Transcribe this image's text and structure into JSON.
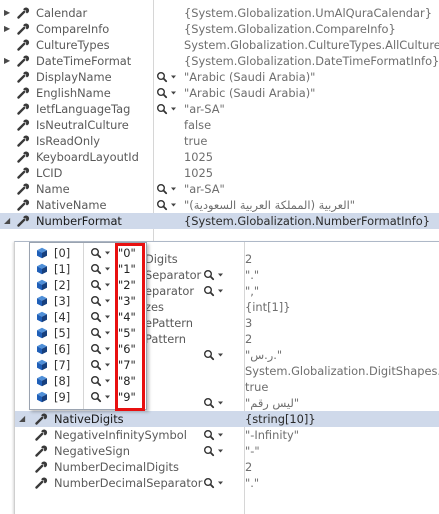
{
  "rows": [
    {
      "name": "Calendar",
      "value": "{System.Globalization.UmAlQuraCalendar}",
      "expandable": true,
      "magnifier": false
    },
    {
      "name": "CompareInfo",
      "value": "{System.Globalization.CompareInfo}",
      "expandable": true,
      "magnifier": false
    },
    {
      "name": "CultureTypes",
      "value": "System.Globalization.CultureTypes.AllCultures",
      "expandable": false,
      "magnifier": false
    },
    {
      "name": "DateTimeFormat",
      "value": "{System.Globalization.DateTimeFormatInfo}",
      "expandable": true,
      "magnifier": false
    },
    {
      "name": "DisplayName",
      "value": "\"Arabic (Saudi Arabia)\"",
      "expandable": false,
      "magnifier": true
    },
    {
      "name": "EnglishName",
      "value": "\"Arabic (Saudi Arabia)\"",
      "expandable": false,
      "magnifier": true
    },
    {
      "name": "IetfLanguageTag",
      "value": "\"ar-SA\"",
      "expandable": false,
      "magnifier": true
    },
    {
      "name": "IsNeutralCulture",
      "value": "false",
      "expandable": false,
      "magnifier": false
    },
    {
      "name": "IsReadOnly",
      "value": "true",
      "expandable": false,
      "magnifier": false
    },
    {
      "name": "KeyboardLayoutId",
      "value": "1025",
      "expandable": false,
      "magnifier": false
    },
    {
      "name": "LCID",
      "value": "1025",
      "expandable": false,
      "magnifier": false
    },
    {
      "name": "Name",
      "value": "\"ar-SA\"",
      "expandable": false,
      "magnifier": true
    },
    {
      "name": "NativeName",
      "value": "\"العربية (المملكة العربية السعودية)\"",
      "expandable": false,
      "magnifier": true
    },
    {
      "name": "NumberFormat",
      "value": "{System.Globalization.NumberFormatInfo}",
      "expandable": true,
      "magnifier": false,
      "expanded": true,
      "selected": true
    }
  ],
  "sub_rows": [
    {
      "name_visible": "Digits",
      "value": "2",
      "magnifier": false
    },
    {
      "name_visible": "Separator",
      "value": "\".\"",
      "magnifier": true
    },
    {
      "name_visible": "eparator",
      "value": "\",\"",
      "magnifier": true
    },
    {
      "name_visible": "zes",
      "value": "{int[1]}",
      "magnifier": false
    },
    {
      "name_visible": "ePattern",
      "value": "3",
      "magnifier": false
    },
    {
      "name_visible": "Pattern",
      "value": "2",
      "magnifier": false
    },
    {
      "name_visible": "",
      "value": "\"ر.س.\"",
      "magnifier": true
    },
    {
      "name_visible": "",
      "value": "System.Globalization.DigitShapes.No",
      "magnifier": false
    },
    {
      "name_visible": "",
      "value": "true",
      "magnifier": false
    },
    {
      "name_visible": "",
      "value": "\"ليس رقم\"",
      "magnifier": true
    },
    {
      "name_visible": "NativeDigits",
      "value": "{string[10]}",
      "magnifier": false,
      "selected": true,
      "expandable": true,
      "expanded": true
    },
    {
      "name_visible": "NegativeInfinitySymbol",
      "value": "\"-Infinity\"",
      "magnifier": true
    },
    {
      "name_visible": "NegativeSign",
      "value": "\"-\"",
      "magnifier": true
    },
    {
      "name_visible": "NumberDecimalDigits",
      "value": "2",
      "magnifier": false
    },
    {
      "name_visible": "NumberDecimalSeparator",
      "value": "\".\"",
      "magnifier": true
    }
  ],
  "native_digits": [
    {
      "index": "[0]",
      "value": "\"0\""
    },
    {
      "index": "[1]",
      "value": "\"1\""
    },
    {
      "index": "[2]",
      "value": "\"2\""
    },
    {
      "index": "[3]",
      "value": "\"3\""
    },
    {
      "index": "[4]",
      "value": "\"4\""
    },
    {
      "index": "[5]",
      "value": "\"5\""
    },
    {
      "index": "[6]",
      "value": "\"6\""
    },
    {
      "index": "[7]",
      "value": "\"7\""
    },
    {
      "index": "[8]",
      "value": "\"8\""
    },
    {
      "index": "[9]",
      "value": "\"9\""
    }
  ],
  "icons": {
    "property": "wrench-icon",
    "visualizer": "magnifier-dropdown-icon",
    "element": "cube-icon",
    "expand": "triangle-icon"
  },
  "colors": {
    "selection": "#cfd9ea",
    "highlight": "#e81010",
    "cube": "#1f5fb8"
  }
}
